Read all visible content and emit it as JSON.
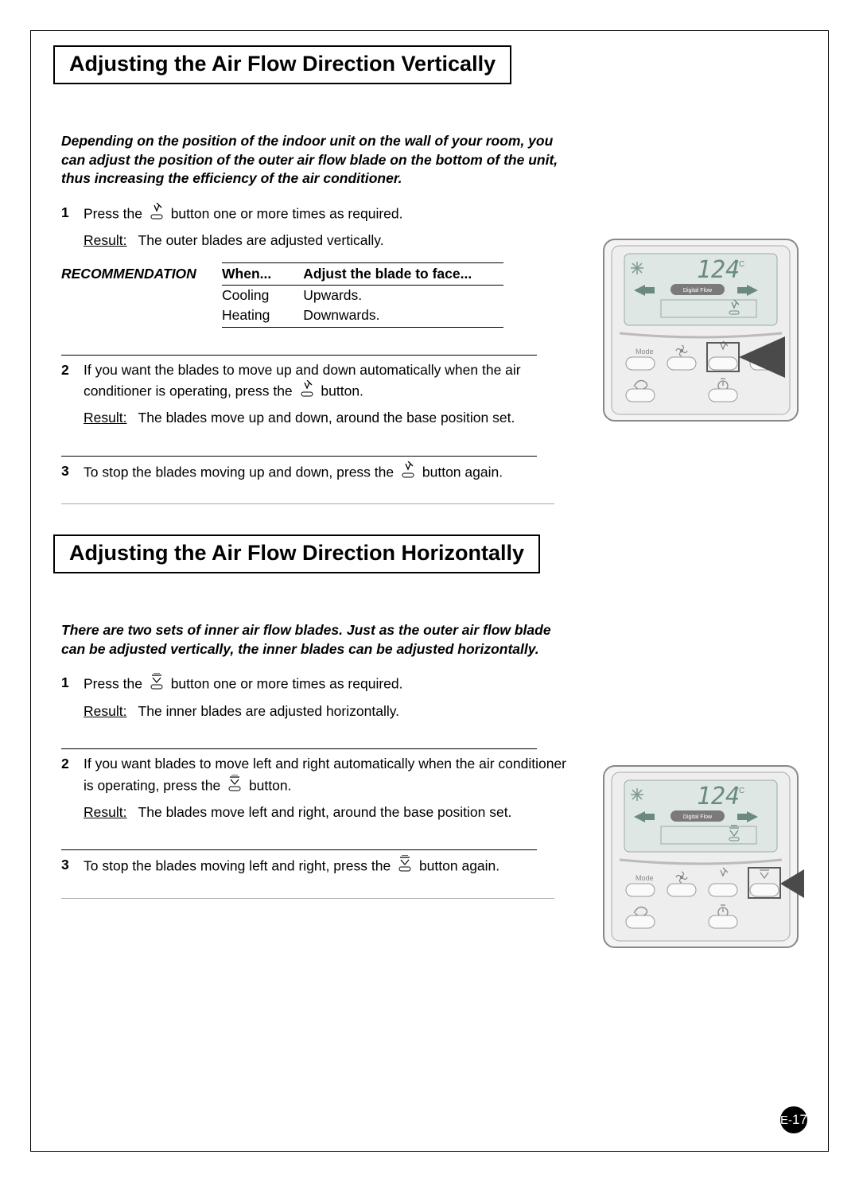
{
  "section1": {
    "title": "Adjusting the Air Flow Direction Vertically",
    "intro": "Depending on the position of the indoor unit on the wall of your room, you can adjust the position of the outer air flow blade on the bottom of the unit, thus increasing the efficiency of the air conditioner.",
    "step1_a": "Press the",
    "step1_b": "button one or more times as required.",
    "step1_result_label": "Result:",
    "step1_result": "The outer blades are adjusted vertically.",
    "rec_label": "RECOMMENDATION",
    "rec_header_when": "When...",
    "rec_header_adjust": "Adjust the blade to face...",
    "rec_rows": [
      {
        "when": "Cooling",
        "adjust": "Upwards."
      },
      {
        "when": "Heating",
        "adjust": "Downwards."
      }
    ],
    "step2_a": "If you want the blades to move up and down automatically when the air conditioner is operating, press the",
    "step2_b": "button.",
    "step2_result_label": "Result:",
    "step2_result": "The blades move up and down, around the base position set.",
    "step3_a": "To stop the blades moving up and down, press the",
    "step3_b": "button again."
  },
  "section2": {
    "title": "Adjusting the Air Flow Direction Horizontally",
    "intro": "There are two sets of inner air flow blades. Just as the outer air flow blade can be adjusted vertically, the inner blades can be adjusted horizontally.",
    "step1_a": "Press the",
    "step1_b": "button one or more times as required.",
    "step1_result_label": "Result:",
    "step1_result": "The inner blades are adjusted horizontally.",
    "step2_a": "If you want blades to move left and right automatically when the air conditioner is operating, press the",
    "step2_b": "button.",
    "step2_result_label": "Result:",
    "step2_result": "The blades move left and right, around the base position set.",
    "step3_a": "To stop the blades moving left and right, press the",
    "step3_b": "button again."
  },
  "remote": {
    "temperature": "124",
    "temp_unit": "°C",
    "display_label": "Digital Flow",
    "mode_label": "Mode"
  },
  "page_number_prefix": "E-",
  "page_number": "17"
}
